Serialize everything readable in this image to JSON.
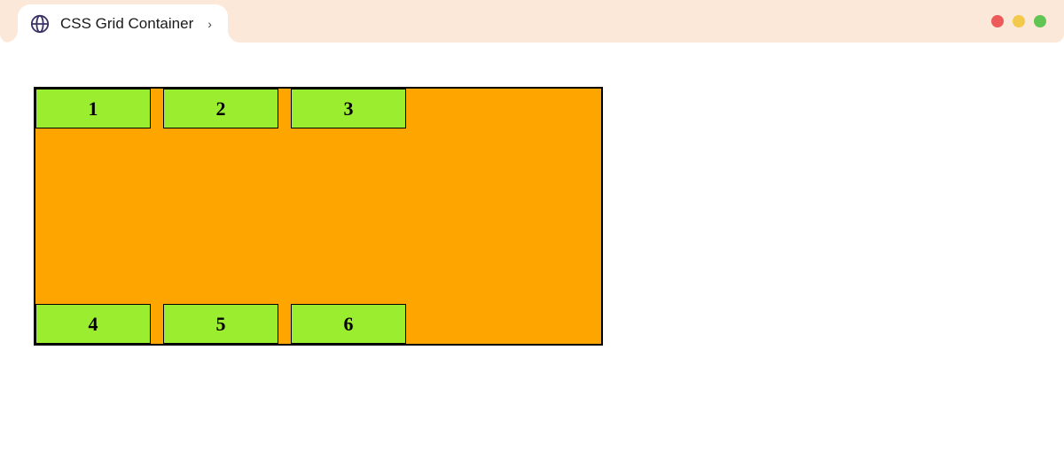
{
  "browser": {
    "tab_title": "CSS Grid Container",
    "chevron": "›"
  },
  "grid": {
    "items": [
      "1",
      "2",
      "3",
      "4",
      "5",
      "6"
    ]
  }
}
